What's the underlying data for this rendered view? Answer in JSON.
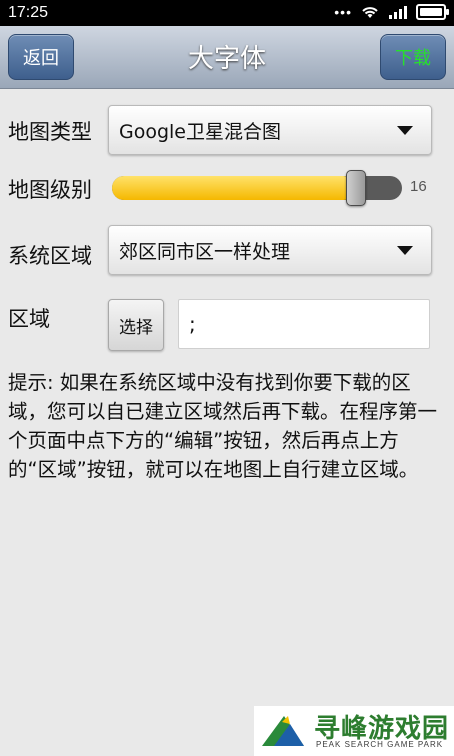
{
  "status_bar": {
    "time": "17:25"
  },
  "header": {
    "title": "大字体",
    "back_label": "返回",
    "download_label": "下载",
    "download_color": "#27e02c"
  },
  "form": {
    "map_type": {
      "label": "地图类型",
      "selected": "Google卫星混合图"
    },
    "map_level": {
      "label": "地图级别",
      "value": "16",
      "fill_fraction": 0.86
    },
    "system_region": {
      "label": "系统区域",
      "selected": "郊区同市区一样处理"
    },
    "region": {
      "label": "区域",
      "choose_label": "选择",
      "value": ";"
    }
  },
  "hint": {
    "text": "提示: 如果在系统区域中没有找到你要下载的区域，您可以自已建立区域然后再下载。在程序第一个页面中点下方的“编辑”按钮，然后再点上方的“区域”按钮，就可以在地图上自行建立区域。"
  },
  "watermark": {
    "title": "寻峰游戏园",
    "subtitle": "PEAK SEARCH GAME PARK"
  },
  "icons": {
    "wifi": "wifi-icon",
    "signal": "signal-icon",
    "battery": "battery-icon",
    "dropdown": "chevron-down-icon"
  }
}
